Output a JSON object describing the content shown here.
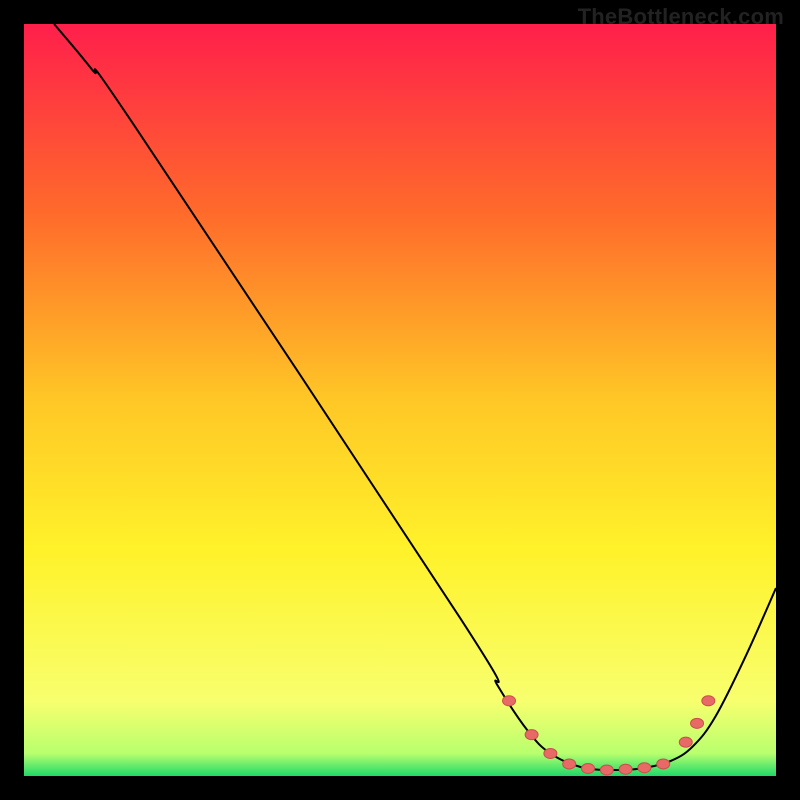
{
  "watermark": "TheBottleneck.com",
  "chart_data": {
    "type": "line",
    "xlim": [
      0,
      100
    ],
    "ylim": [
      0,
      100
    ],
    "title": "",
    "xlabel": "",
    "ylabel": "",
    "grid": false,
    "gradient_stops": [
      {
        "offset": 0,
        "color": "#ff1f4b"
      },
      {
        "offset": 25,
        "color": "#ff6a2b"
      },
      {
        "offset": 50,
        "color": "#ffc726"
      },
      {
        "offset": 70,
        "color": "#fff22a"
      },
      {
        "offset": 90,
        "color": "#f8ff6e"
      },
      {
        "offset": 97,
        "color": "#b8ff6e"
      },
      {
        "offset": 100,
        "color": "#1fd96a"
      }
    ],
    "series": [
      {
        "name": "curve",
        "color": "#000000",
        "stroke_width": 2,
        "points": [
          {
            "x": 4,
            "y": 100
          },
          {
            "x": 9,
            "y": 94
          },
          {
            "x": 15,
            "y": 86
          },
          {
            "x": 58,
            "y": 21
          },
          {
            "x": 63,
            "y": 12
          },
          {
            "x": 67,
            "y": 6
          },
          {
            "x": 70,
            "y": 3
          },
          {
            "x": 74,
            "y": 1.2
          },
          {
            "x": 78,
            "y": 0.8
          },
          {
            "x": 82,
            "y": 1.0
          },
          {
            "x": 86,
            "y": 2.0
          },
          {
            "x": 89,
            "y": 4
          },
          {
            "x": 92,
            "y": 8
          },
          {
            "x": 96,
            "y": 16
          },
          {
            "x": 100,
            "y": 25
          }
        ]
      }
    ],
    "markers": {
      "color": "#e86a66",
      "stroke": "#c94f4b",
      "rx": 6.5,
      "ry": 5,
      "points": [
        {
          "x": 64.5,
          "y": 10
        },
        {
          "x": 67.5,
          "y": 5.5
        },
        {
          "x": 70,
          "y": 3
        },
        {
          "x": 72.5,
          "y": 1.6
        },
        {
          "x": 75,
          "y": 1.0
        },
        {
          "x": 77.5,
          "y": 0.8
        },
        {
          "x": 80,
          "y": 0.9
        },
        {
          "x": 82.5,
          "y": 1.1
        },
        {
          "x": 85,
          "y": 1.6
        },
        {
          "x": 88,
          "y": 4.5
        },
        {
          "x": 89.5,
          "y": 7
        },
        {
          "x": 91,
          "y": 10
        }
      ]
    }
  }
}
